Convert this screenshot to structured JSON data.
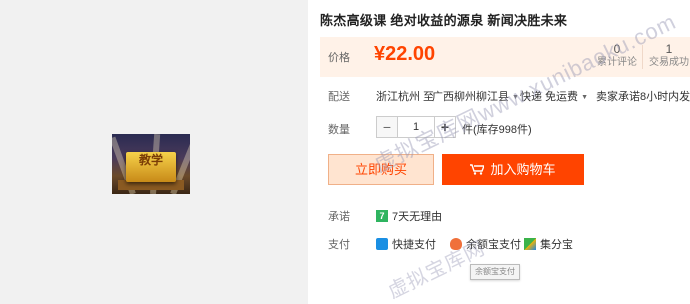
{
  "product": {
    "title": "陈杰高级课 绝对收益的源泉 新闻决胜未来",
    "thumbnail_caption": "教学"
  },
  "price": {
    "label": "价格",
    "value": "¥22.00",
    "reviews_count": "0",
    "reviews_label": "累计评论",
    "sales_count": "1",
    "sales_label": "交易成功"
  },
  "shipping": {
    "label": "配送",
    "from": "浙江杭州 至",
    "to": "广西柳州柳江县",
    "method": "快递 免运费",
    "note": "卖家承诺8小时内发货"
  },
  "quantity": {
    "label": "数量",
    "minus": "−",
    "value": "1",
    "plus": "+",
    "stock": "件(库存998件)"
  },
  "actions": {
    "buy_label": "立即购买",
    "cart_label": "加入购物车"
  },
  "promise": {
    "label": "承诺",
    "text": "7天无理由",
    "badge": "7"
  },
  "payment": {
    "label": "支付",
    "methods": [
      "快捷支付",
      "余额宝支付",
      "集分宝"
    ],
    "tooltip": "余额宝支付"
  },
  "watermark": {
    "line1": "虚拟宝库网www.xunibaoku.com",
    "line2": "虚拟宝库网"
  },
  "colors": {
    "accent": "#ff4400",
    "price_bg": "#fff2e8",
    "buy_bg": "#ffe4d0"
  }
}
